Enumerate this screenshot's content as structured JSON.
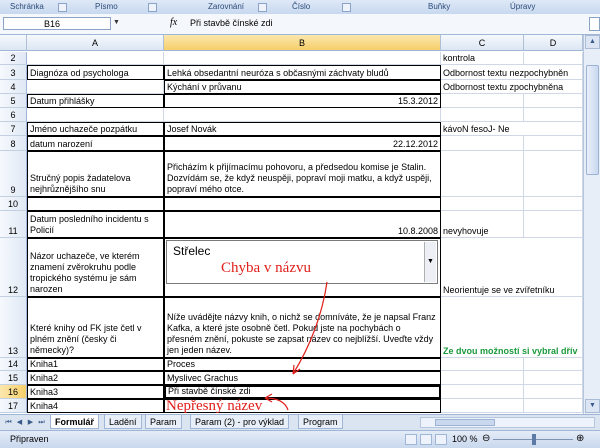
{
  "ribbon": {
    "groups": [
      "Schránka",
      "Písmo",
      "Zarovnání",
      "Číslo",
      "Buňky",
      "Úpravy"
    ]
  },
  "formula_bar": {
    "name_box": "B16",
    "fx": "fx",
    "content": "Při stavbě čínské zdi"
  },
  "columns": [
    "A",
    "B",
    "C",
    "D"
  ],
  "rows": [
    {
      "num": "2",
      "a": "",
      "b": "",
      "c": "kontrola",
      "d": ""
    },
    {
      "num": "3",
      "a": "Diagnóza od psychologa",
      "b": "Lehká obsedantní neuróza s občasnými záchvaty bludů",
      "c": "Odbornost textu nezpochybněn",
      "d": ""
    },
    {
      "num": "4",
      "a": "",
      "b": "Kýchání v průvanu",
      "c": "Odbornost textu zpochybněna",
      "d": ""
    },
    {
      "num": "5",
      "a": "Datum přihlášky",
      "b": "15.3.2012",
      "c": "",
      "d": ""
    },
    {
      "num": "6",
      "a": "",
      "b": "",
      "c": "",
      "d": ""
    },
    {
      "num": "7",
      "a": "Jméno uchazeče pozpátku",
      "b": "Josef Novák",
      "c": "kávoN fesoJ- Ne",
      "d": ""
    },
    {
      "num": "8",
      "a": "datum narození",
      "b": "22.12.2012",
      "c": "",
      "d": ""
    },
    {
      "num": "9",
      "a": "Stručný popis žadatelova nejhrůznějšího snu",
      "b": "Přicházím k přijímacímu pohovoru, a předsedou komise je Stalin. Dozvídám se, že když neuspěji, popraví moji matku, a když uspěji, popraví mého otce.",
      "c": "",
      "d": ""
    },
    {
      "num": "10",
      "a": "",
      "b": "",
      "c": "",
      "d": ""
    },
    {
      "num": "11",
      "a": "Datum posledního incidentu s Policií",
      "b": "10.8.2008",
      "c": "nevyhovuje",
      "d": ""
    },
    {
      "num": "12",
      "a": "Názor uchazeče, ve kterém znamení zvěrokruhu podle tropického systému je sám narozen",
      "b": "Střelec",
      "c": "Neorientuje se ve zvířetníku",
      "d": ""
    },
    {
      "num": "13",
      "a": "Které knihy od FK jste četl v plném znění (česky či německy)?",
      "b": "Níže uvádějte názvy knih, o nichž se domníváte, že je napsal Franz Kafka, a které jste osobně četl. Pokud jste na pochybách o přesném znění, pokuste se zapsat název co nejblížší. Uveďte vždy jen jeden název.",
      "c": "Ze dvou možností si vybral dřív",
      "d": ""
    },
    {
      "num": "14",
      "a": "Kniha1",
      "b": "Proces",
      "c": "",
      "d": ""
    },
    {
      "num": "15",
      "a": "Kniha2",
      "b": "Myslivec Grachus",
      "c": "",
      "d": ""
    },
    {
      "num": "16",
      "a": "Kniha3",
      "b": "Při stavbě čínské zdi",
      "c": "",
      "d": ""
    },
    {
      "num": "17",
      "a": "Kniha4",
      "b": "",
      "c": "",
      "d": ""
    }
  ],
  "annotations": {
    "chyba": "Chyba v názvu",
    "nepresny": "Nepřesný název"
  },
  "colors": {
    "annotation_red": "#e0201b",
    "green_text": "#1a9a3c",
    "selection": "#f6cf6a"
  },
  "sheet_tabs": [
    "Formulář",
    "Ladění",
    "Param",
    "Param (2) - pro výklad",
    "Program"
  ],
  "status": {
    "ready": "Připraven",
    "zoom": "100 %"
  }
}
